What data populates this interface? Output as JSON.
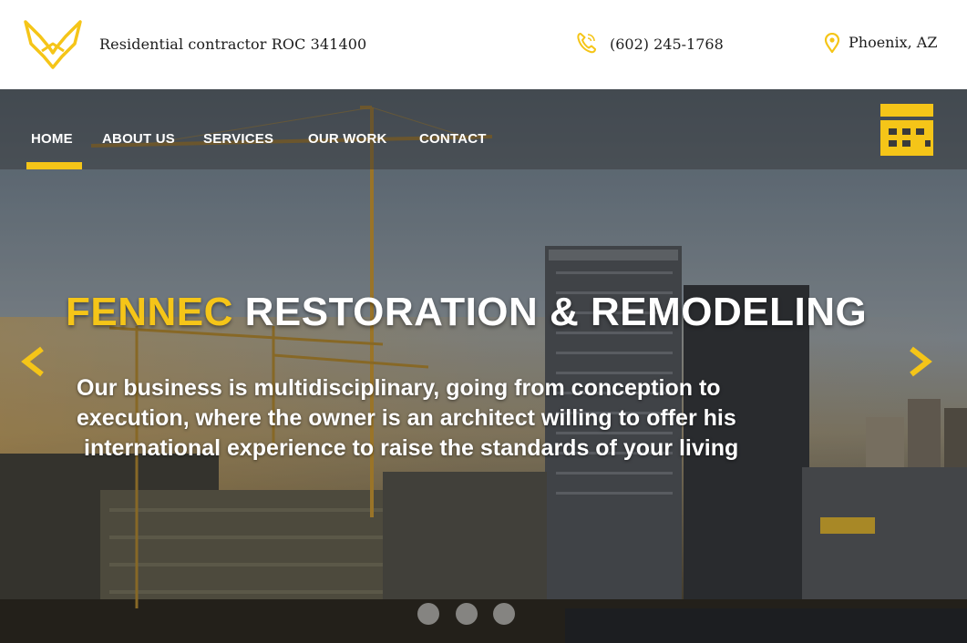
{
  "header": {
    "tagline": "Residential contractor ROC 341400",
    "phone": "(602) 245-1768",
    "location": "Phoenix, AZ"
  },
  "nav": {
    "items": [
      {
        "label": "HOME",
        "active": true
      },
      {
        "label": "ABOUT US",
        "active": false
      },
      {
        "label": "SERVICES",
        "active": false
      },
      {
        "label": "OUR WORK",
        "active": false
      },
      {
        "label": "CONTACT",
        "active": false
      }
    ]
  },
  "hero": {
    "headline_brand": "FENNEC",
    "headline_rest": " RESTORATION & REMODELING",
    "subtext_lines": [
      "Our business is multidisciplinary, going from conception to",
      "execution, where the owner is an architect willing to offer his",
      "international experience to raise the standards of your living"
    ],
    "slide_count": 3
  },
  "icons": {
    "logo": "fennec-logo-icon",
    "phone": "phone-icon",
    "location": "map-pin-icon",
    "calendar": "calendar-icon",
    "prev": "chevron-left-icon",
    "next": "chevron-right-icon"
  },
  "colors": {
    "accent": "#f5c518",
    "nav_text": "#ffffff",
    "header_text": "#1d1d1d"
  }
}
